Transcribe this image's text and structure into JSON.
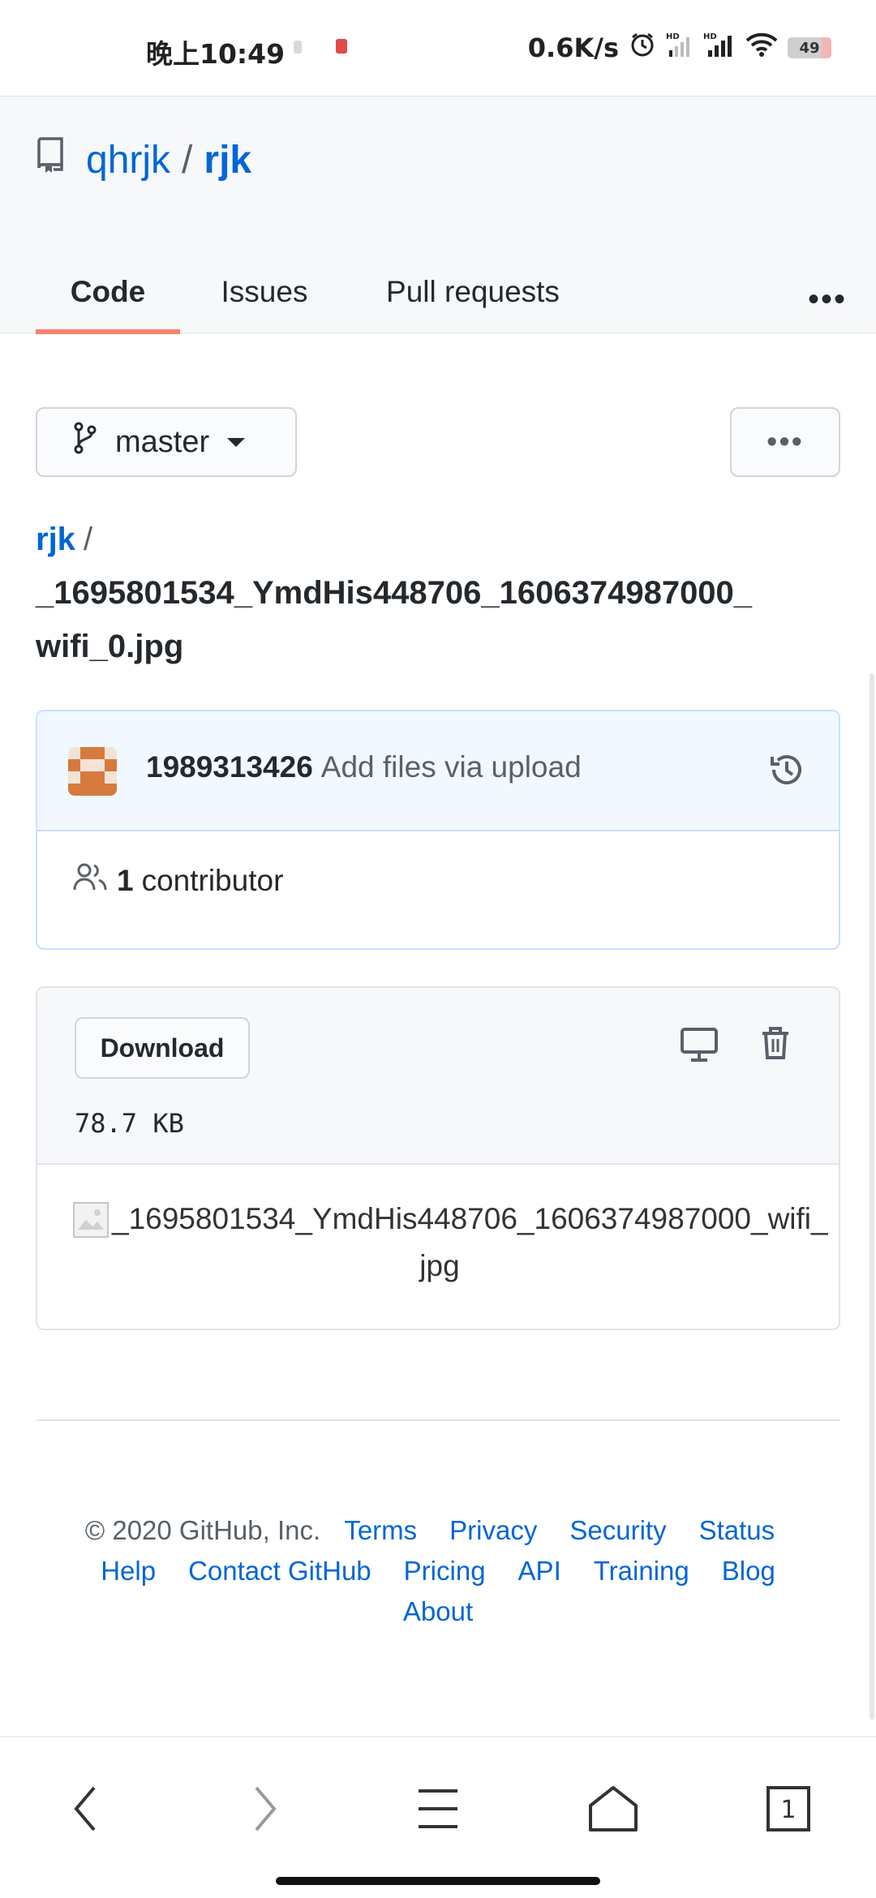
{
  "status_bar": {
    "time": "晚上10:49",
    "speed": "0.6K/s",
    "battery": "49"
  },
  "repo": {
    "owner": "qhrjk",
    "separator": "/",
    "name": "rjk"
  },
  "tabs": [
    {
      "label": "Code",
      "active": true
    },
    {
      "label": "Issues",
      "active": false
    },
    {
      "label": "Pull requests",
      "active": false
    }
  ],
  "tabs_more": "•••",
  "branch": {
    "label": "master"
  },
  "more_button": "•••",
  "path": {
    "root": "rjk",
    "slash": "/",
    "file": "_1695801534_YmdHis448706_1606374987000_ wifi_0.jpg"
  },
  "commit": {
    "user": "1989313426",
    "message": "Add files via upload"
  },
  "contributors": {
    "count": "1",
    "label": "contributor"
  },
  "file_view": {
    "download_label": "Download",
    "size": "78.7 KB",
    "image_alt_line1": "_1695801534_YmdHis448706_1606374987000_wifi_",
    "image_alt_line2": "jpg"
  },
  "footer": {
    "copyright": "© 2020 GitHub, Inc.",
    "links": [
      "Terms",
      "Privacy",
      "Security",
      "Status",
      "Help",
      "Contact GitHub",
      "Pricing",
      "API",
      "Training",
      "Blog",
      "About"
    ]
  },
  "colors": {
    "link": "#0366d6",
    "tab_underline": "#f9826c",
    "commit_bg": "#f1f8ff"
  },
  "nav": {
    "tab_count": "1"
  }
}
